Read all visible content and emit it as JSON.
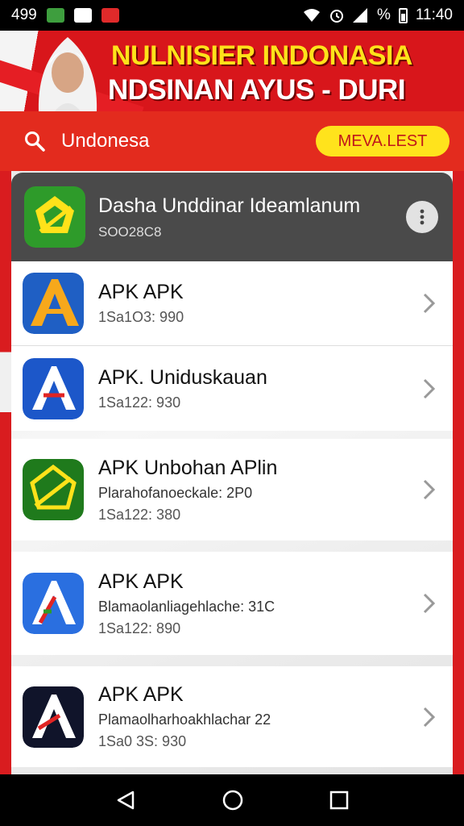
{
  "status_bar": {
    "left_text": "499",
    "time": "11:40",
    "percent_sign": "%",
    "icons": [
      "notification-icon",
      "image-icon",
      "record-icon",
      "wifi-icon",
      "alarm-icon",
      "signal-icon",
      "battery-icon"
    ]
  },
  "banner": {
    "title": "NULNISIER INDONASIA",
    "subtitle": "NDSINAN AYUS - DURI",
    "colors": {
      "red": "#d8161b",
      "yellow": "#ffe21a"
    }
  },
  "search": {
    "value": "Undonesa",
    "button_label": "MEVA.LEST"
  },
  "header": {
    "title": "Dasha Unddinar Ideamlanum",
    "code": "SOO28C8"
  },
  "items": [
    {
      "title": "APK APK",
      "description": "",
      "meta": "1Sa1O3: 990"
    },
    {
      "title": "APK. Uniduskauan",
      "description": "",
      "meta": "1Sa122: 930"
    },
    {
      "title": "APK Unbohan APlin",
      "description": "Plarahofanoeckale: 2P0",
      "meta": "1Sa122: 380"
    },
    {
      "title": "APK APK",
      "description": "Blamaolanliagehlache: 31C",
      "meta": "1Sa122: 890"
    },
    {
      "title": "APK APK",
      "description": "Plamaolharhoakhlachar 22",
      "meta": "1Sa0 3S: 930"
    }
  ],
  "nav": [
    "back-icon",
    "home-icon",
    "recents-icon"
  ]
}
